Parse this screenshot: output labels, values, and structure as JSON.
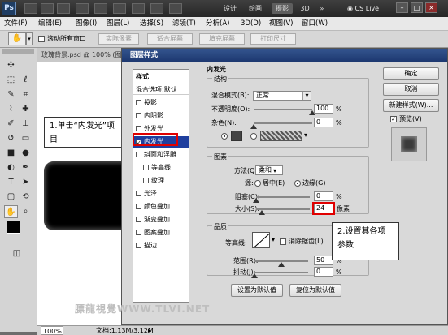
{
  "titlebar": {
    "logo": "Ps",
    "workspaces": [
      "设计",
      "绘画",
      "摄影",
      "3D"
    ],
    "more": "»",
    "cs_live": "CS Live",
    "window_buttons": {
      "minimize": "–",
      "restore": "□",
      "close": "×"
    }
  },
  "menubar": [
    "文件(F)",
    "编辑(E)",
    "图像(I)",
    "图层(L)",
    "选择(S)",
    "滤镜(T)",
    "分析(A)",
    "3D(D)",
    "视图(V)",
    "窗口(W)"
  ],
  "options": {
    "scroll_all": "滚动所有窗口",
    "buttons": [
      "实际像素",
      "适合屏幕",
      "填充屏幕",
      "打印尺寸"
    ]
  },
  "document": {
    "tab_title": "玫瑰背景.psd @ 100% (图层",
    "zoom": "100%",
    "doc_info": "文档:1.13M/3.12M"
  },
  "callouts": {
    "step1": "1.单击“内发光”项目",
    "step2": "2.设置其各项参数"
  },
  "watermark": "膘龍視覺WWW.TLVI.NET",
  "dialog": {
    "title": "图层样式",
    "styles_header": "样式",
    "blend_options": "混合选项:默认",
    "styles": [
      "投影",
      "内阴影",
      "外发光",
      "内发光",
      "斜面和浮雕",
      "等高线",
      "纹理",
      "光泽",
      "颜色叠加",
      "渐变叠加",
      "图案叠加",
      "描边"
    ],
    "selected_style": "内发光",
    "section_title": "内发光",
    "structure": {
      "title": "结构",
      "blend_mode_label": "混合模式(B):",
      "blend_mode": "正常",
      "opacity_label": "不透明度(O):",
      "opacity": "100",
      "noise_label": "杂色(N):",
      "noise": "0",
      "percent": "%",
      "color": "#444444"
    },
    "elements": {
      "title": "图素",
      "method_label": "方法(Q):",
      "method": "柔和",
      "source_label": "源:",
      "source_center": "居中(E)",
      "source_edge": "边缘(G)",
      "choke_label": "阻塞(C):",
      "choke": "0",
      "size_label": "大小(S):",
      "size": "24",
      "pixels": "像素",
      "percent": "%"
    },
    "quality": {
      "title": "品质",
      "contour_label": "等高线:",
      "anti_alias": "消除锯齿(L)",
      "range_label": "范围(R):",
      "range": "50",
      "jitter_label": "抖动(J):",
      "jitter": "0",
      "percent": "%"
    },
    "make_default": "设置为默认值",
    "reset_default": "复位为默认值",
    "ok": "确定",
    "cancel": "取消",
    "new_style": "新建样式(W)...",
    "preview": "预览(V)"
  }
}
